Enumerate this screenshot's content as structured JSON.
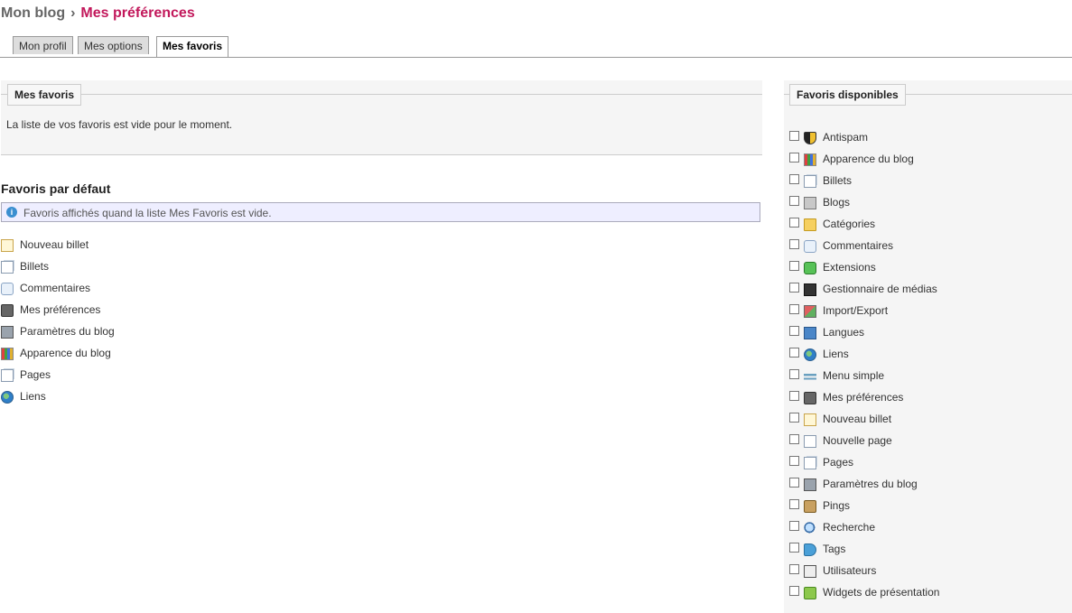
{
  "header": {
    "breadcrumb_root": "Mon blog",
    "separator": "›",
    "current": "Mes préférences"
  },
  "tabs": [
    {
      "label": "Mon profil",
      "active": false
    },
    {
      "label": "Mes options",
      "active": false
    },
    {
      "label": "Mes favoris",
      "active": true
    }
  ],
  "my_favorites": {
    "legend": "Mes favoris",
    "empty_message": "La liste de vos favoris est vide pour le moment."
  },
  "default_favorites": {
    "title": "Favoris par défaut",
    "info": "Favoris affichés quand la liste Mes Favoris est vide.",
    "items": [
      {
        "label": "Nouveau billet",
        "icon": "new-post-icon"
      },
      {
        "label": "Billets",
        "icon": "posts-icon"
      },
      {
        "label": "Commentaires",
        "icon": "comments-icon"
      },
      {
        "label": "Mes préférences",
        "icon": "preferences-icon"
      },
      {
        "label": "Paramètres du blog",
        "icon": "blog-settings-icon"
      },
      {
        "label": "Apparence du blog",
        "icon": "blog-theme-icon"
      },
      {
        "label": "Pages",
        "icon": "pages-icon"
      },
      {
        "label": "Liens",
        "icon": "links-icon"
      }
    ]
  },
  "available_favorites": {
    "legend": "Favoris disponibles",
    "items": [
      {
        "label": "Antispam",
        "icon": "antispam-icon",
        "checked": false
      },
      {
        "label": "Apparence du blog",
        "icon": "blog-theme-icon",
        "checked": false
      },
      {
        "label": "Billets",
        "icon": "posts-icon",
        "checked": false
      },
      {
        "label": "Blogs",
        "icon": "blogs-icon",
        "checked": false
      },
      {
        "label": "Catégories",
        "icon": "categories-icon",
        "checked": false
      },
      {
        "label": "Commentaires",
        "icon": "comments-icon",
        "checked": false
      },
      {
        "label": "Extensions",
        "icon": "plugins-icon",
        "checked": false
      },
      {
        "label": "Gestionnaire de médias",
        "icon": "media-icon",
        "checked": false
      },
      {
        "label": "Import/Export",
        "icon": "import-export-icon",
        "checked": false
      },
      {
        "label": "Langues",
        "icon": "languages-icon",
        "checked": false
      },
      {
        "label": "Liens",
        "icon": "links-icon",
        "checked": false
      },
      {
        "label": "Menu simple",
        "icon": "simple-menu-icon",
        "checked": false
      },
      {
        "label": "Mes préférences",
        "icon": "preferences-icon",
        "checked": false
      },
      {
        "label": "Nouveau billet",
        "icon": "new-post-icon",
        "checked": false
      },
      {
        "label": "Nouvelle page",
        "icon": "new-page-icon",
        "checked": false
      },
      {
        "label": "Pages",
        "icon": "pages-icon",
        "checked": false
      },
      {
        "label": "Paramètres du blog",
        "icon": "blog-settings-icon",
        "checked": false
      },
      {
        "label": "Pings",
        "icon": "pings-icon",
        "checked": false
      },
      {
        "label": "Recherche",
        "icon": "search-icon",
        "checked": false
      },
      {
        "label": "Tags",
        "icon": "tags-icon",
        "checked": false
      },
      {
        "label": "Utilisateurs",
        "icon": "users-icon",
        "checked": false
      },
      {
        "label": "Widgets de présentation",
        "icon": "widgets-icon",
        "checked": false
      }
    ]
  }
}
